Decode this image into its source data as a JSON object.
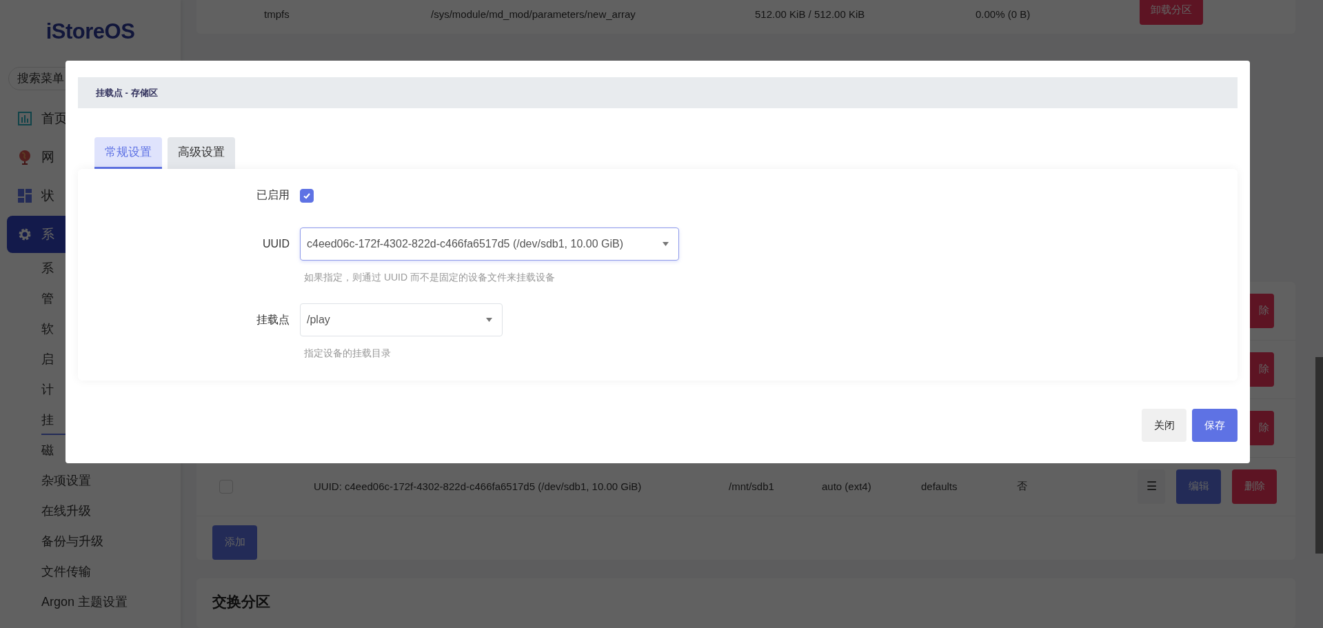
{
  "sidebar": {
    "logo": "iStoreOS",
    "search": {
      "placeholder": "搜索菜单"
    },
    "items": [
      {
        "label": "首页",
        "selected": false
      },
      {
        "label": "网",
        "selected": false
      },
      {
        "label": "状",
        "selected": false
      },
      {
        "label": "系",
        "selected": true
      }
    ],
    "subitems": [
      {
        "label": "系",
        "selected": false
      },
      {
        "label": "管",
        "selected": false
      },
      {
        "label": "软",
        "selected": false
      },
      {
        "label": "启",
        "selected": false
      },
      {
        "label": "计",
        "selected": false
      },
      {
        "label": "挂",
        "selected": true
      },
      {
        "label": "磁",
        "selected": false
      },
      {
        "label": "杂项设置",
        "selected": false
      },
      {
        "label": "在线升级",
        "selected": false
      },
      {
        "label": "备份与升级",
        "selected": false
      },
      {
        "label": "文件传输",
        "selected": false
      },
      {
        "label": "Argon 主题设置",
        "selected": false
      }
    ]
  },
  "background": {
    "top_row": {
      "cells": [
        "tmpfs",
        "/sys/module/md_mod/parameters/new_array",
        "512.00 KiB / 512.00 KiB",
        "0.00% (0 B)"
      ],
      "button": "卸载分区"
    },
    "hidden_rows": [
      {
        "delete": "除"
      },
      {
        "delete": "除"
      },
      {
        "delete": "除"
      }
    ],
    "mount_row": {
      "checked": false,
      "cells": [
        "UUID: c4eed06c-172f-4302-822d-c466fa6517d5 (/dev/sdb1, 10.00 GiB)",
        "/mnt/sdb1",
        "auto (ext4)",
        "defaults",
        "否"
      ],
      "menu": "☰",
      "edit": "编辑",
      "delete": "删除"
    },
    "add_button": "添加",
    "next_section": "交换分区"
  },
  "modal": {
    "title": "挂载点 - 存储区",
    "tabs": [
      {
        "label": "常规设置",
        "selected": true
      },
      {
        "label": "高级设置",
        "selected": false
      }
    ],
    "enabled": {
      "label": "已启用",
      "checked": true
    },
    "fields": [
      {
        "label": "UUID",
        "value": "c4eed06c-172f-4302-822d-c466fa6517d5 (/dev/sdb1, 10.00 GiB)",
        "help": "如果指定，则通过 UUID 而不是固定的设备文件来挂载设备",
        "focused": true
      },
      {
        "label": "挂载点",
        "value": "/play",
        "help": "指定设备的挂载目录",
        "focused": false
      }
    ],
    "buttons": [
      {
        "label": "关闭",
        "kind": "secondary"
      },
      {
        "label": "保存",
        "kind": "primary"
      }
    ]
  }
}
